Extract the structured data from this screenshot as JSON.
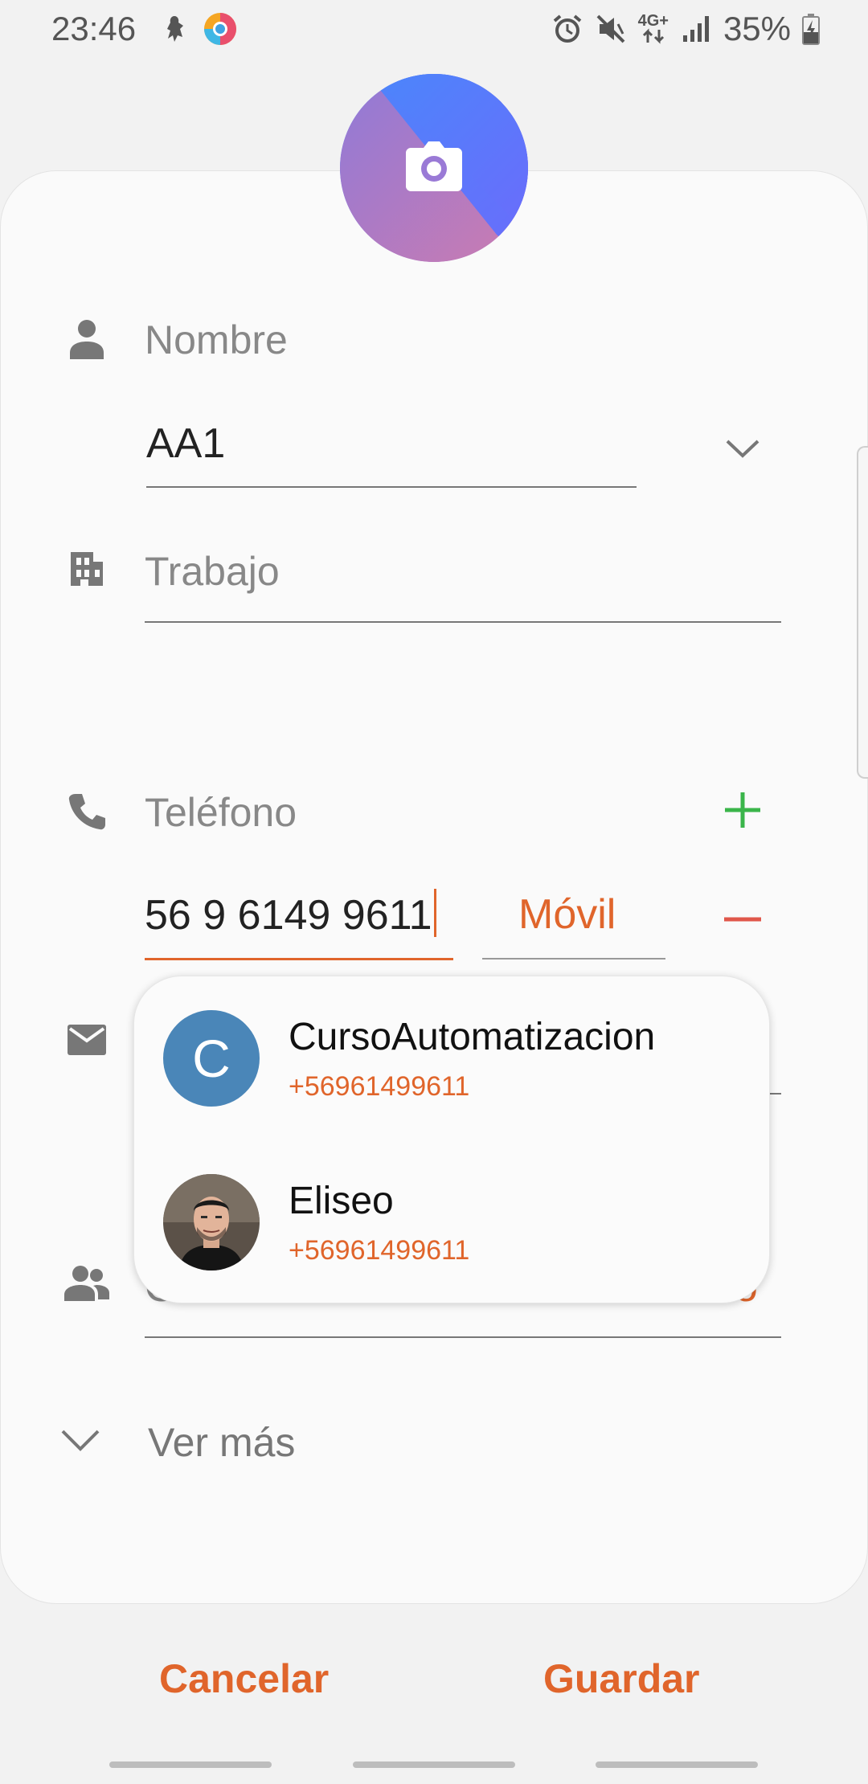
{
  "status_bar": {
    "time": "23:46",
    "battery": "35%",
    "network": "4G+",
    "icons": [
      "notification-icon",
      "chrome-app-icon",
      "alarm-icon",
      "mute-icon",
      "data-icon",
      "signal-icon",
      "battery-charging-icon"
    ]
  },
  "photo": {
    "icon": "camera-icon"
  },
  "name_field": {
    "label": "Nombre",
    "value": "AA1"
  },
  "work_field": {
    "label": "Trabajo"
  },
  "phone_field": {
    "label": "Teléfono",
    "value": "56 9 6149 9611",
    "type": "Móvil"
  },
  "group_field": {
    "label": "G",
    "value": "do"
  },
  "suggestions": [
    {
      "initial": "C",
      "name": "CursoAutomatizacion",
      "phone": "+56961499611"
    },
    {
      "name": "Eliseo",
      "phone": "+56961499611"
    }
  ],
  "see_more": {
    "label": "Ver más"
  },
  "actions": {
    "cancel": "Cancelar",
    "save": "Guardar"
  },
  "colors": {
    "accent": "#e0652b",
    "add_green": "#3ab54a",
    "avatar_blue": "#4a86b8"
  }
}
